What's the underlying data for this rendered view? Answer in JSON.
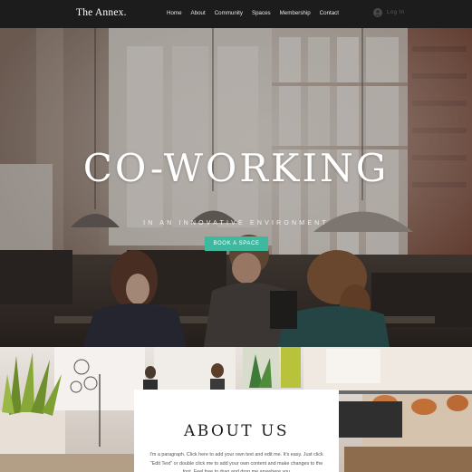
{
  "header": {
    "logo": "The Annex.",
    "nav": [
      "Home",
      "About",
      "Community",
      "Spaces",
      "Membership",
      "Contact"
    ],
    "login_icon": "user-avatar-icon",
    "login_label": "Log In"
  },
  "hero": {
    "title": "CO-WORKING",
    "subtitle": "IN AN INNOVATIVE ENVIRONMENT",
    "cta_label": "BOOK A SPACE"
  },
  "about": {
    "title": "ABOUT US",
    "paragraph": "I'm a paragraph. Click here to add your own text and edit me. It's easy. Just click \"Edit Text\" or double click me to add your own content and make changes to the font. Feel free to drag and drop me anywhere you"
  },
  "colors": {
    "header_bg": "#1c1c1c",
    "accent": "#3fb8a0",
    "card_bg": "#ffffff"
  }
}
